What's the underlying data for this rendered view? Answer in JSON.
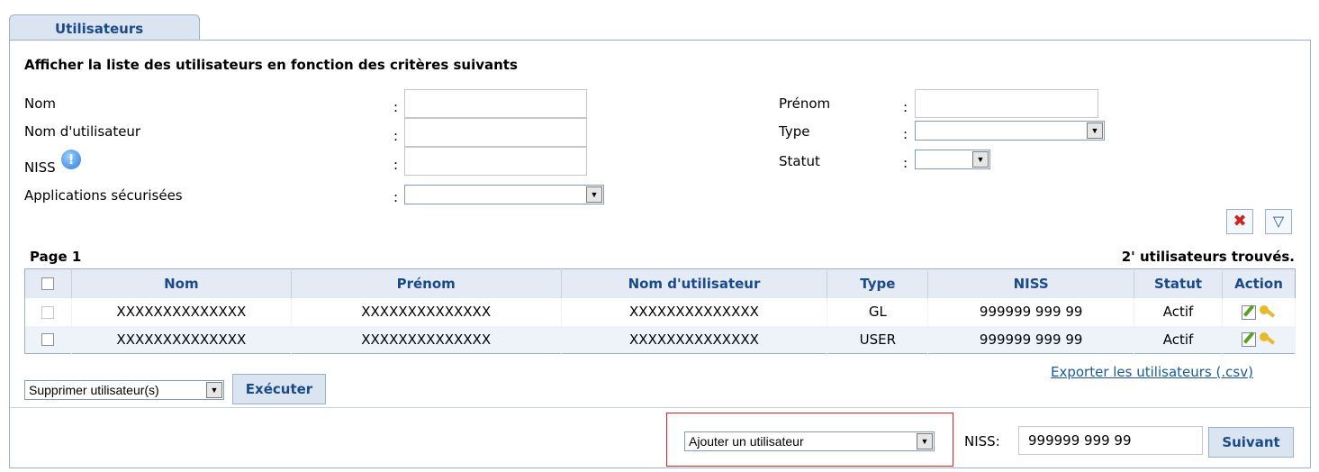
{
  "tab": {
    "label": "Utilisateurs"
  },
  "filters": {
    "heading": "Afficher la liste des utilisateurs en fonction des critères suivants",
    "colon": ":",
    "nom_label": "Nom",
    "nom_utilisateur_label": "Nom d'utilisateur",
    "niss_label": "NISS",
    "applications_label": "Applications sécurisées",
    "prenom_label": "Prénom",
    "type_label": "Type",
    "statut_label": "Statut",
    "applications_value": "",
    "type_value": "",
    "statut_value": ""
  },
  "icons": {
    "clear_filter": "clear-filter-icon",
    "filter": "filter-icon",
    "info": "info-icon",
    "edit": "edit-icon",
    "key": "key-icon"
  },
  "results": {
    "page_label": "Page 1",
    "count_label": "2' utilisateurs trouvés.",
    "columns": [
      "Nom",
      "Prénom",
      "Nom d'utilisateur",
      "Type",
      "NISS",
      "Statut",
      "Action"
    ],
    "rows": [
      {
        "nom": "XXXXXXXXXXXXXX",
        "prenom": "XXXXXXXXXXXXXX",
        "nom_utilisateur": "XXXXXXXXXXXXXX",
        "type": "GL",
        "niss": "999999 999 99",
        "statut": "Actif"
      },
      {
        "nom": "XXXXXXXXXXXXXX",
        "prenom": "XXXXXXXXXXXXXX",
        "nom_utilisateur": "XXXXXXXXXXXXXX",
        "type": "USER",
        "niss": "999999 999 99",
        "statut": "Actif"
      }
    ]
  },
  "bulk_action": {
    "select_value": "Supprimer utilisateur(s)",
    "execute_label": "Exécuter"
  },
  "export_link": "Exporter les utilisateurs (.csv)",
  "add_user": {
    "select_value": "Ajouter un utilisateur",
    "niss_label": "NISS:",
    "niss_value": "999999 999 99",
    "next_label": "Suivant"
  },
  "colors": {
    "accent": "#1a4a8a",
    "tab_bg": "#dbe5f1",
    "highlight_border": "#e02020"
  }
}
